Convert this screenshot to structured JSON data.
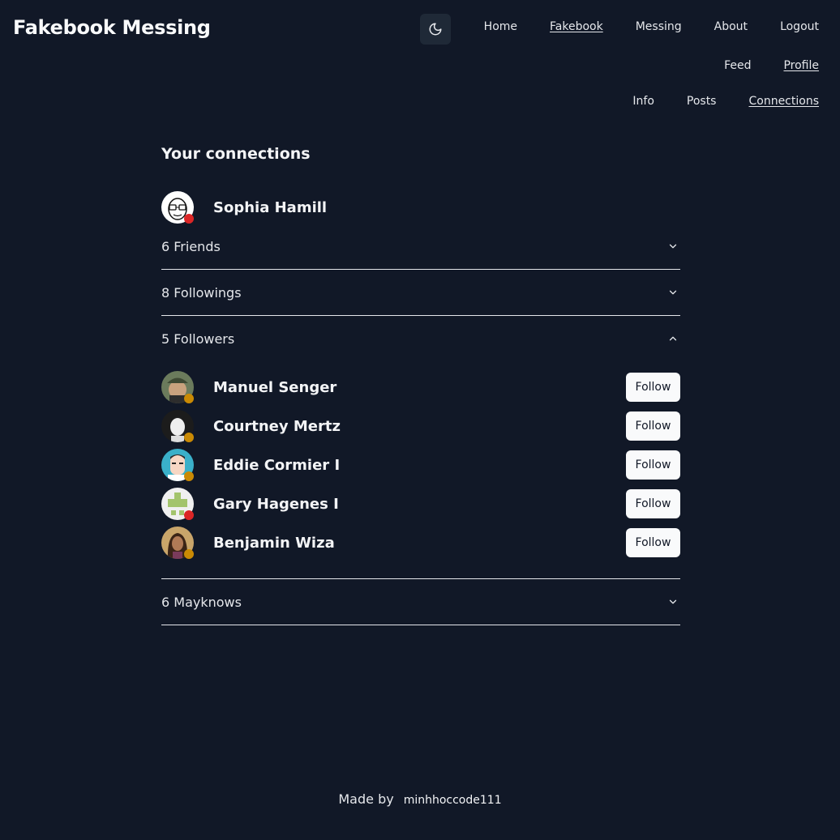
{
  "app": {
    "title": "Fakebook Messing"
  },
  "nav": {
    "primary": [
      {
        "label": "Home",
        "active": false
      },
      {
        "label": "Fakebook",
        "active": true
      },
      {
        "label": "Messing",
        "active": false
      },
      {
        "label": "About",
        "active": false
      },
      {
        "label": "Logout",
        "active": false
      }
    ],
    "secondary": [
      {
        "label": "Feed",
        "active": false
      },
      {
        "label": "Profile",
        "active": true
      }
    ],
    "tertiary": [
      {
        "label": "Info",
        "active": false
      },
      {
        "label": "Posts",
        "active": false
      },
      {
        "label": "Connections",
        "active": true
      }
    ]
  },
  "main": {
    "heading": "Your connections",
    "me": {
      "name": "Sophia Hamill",
      "status": "offline"
    },
    "sections": [
      {
        "label": "6 Friends",
        "expanded": false,
        "users": []
      },
      {
        "label": "8 Followings",
        "expanded": false,
        "users": []
      },
      {
        "label": "5 Followers",
        "expanded": true,
        "users": [
          {
            "name": "Manuel Senger",
            "status": "away",
            "button": "Follow"
          },
          {
            "name": "Courtney Mertz",
            "status": "away",
            "button": "Follow"
          },
          {
            "name": "Eddie Cormier I",
            "status": "away",
            "button": "Follow"
          },
          {
            "name": "Gary Hagenes I",
            "status": "offline",
            "button": "Follow"
          },
          {
            "name": "Benjamin Wiza",
            "status": "away",
            "button": "Follow"
          }
        ]
      },
      {
        "label": "6 Mayknows",
        "expanded": false,
        "users": []
      }
    ]
  },
  "footer": {
    "made_by": "Made by",
    "author": "minhhoccode111"
  },
  "colors": {
    "background": "#111827",
    "status_offline": "#dc2626",
    "status_away": "#ca8a04",
    "button_bg": "#f9fafb"
  }
}
